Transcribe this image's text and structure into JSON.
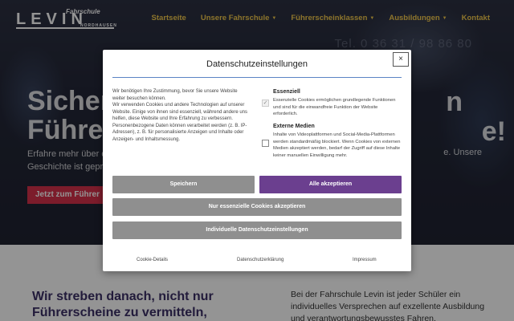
{
  "logo": {
    "top": "Fahrschule",
    "main": "LEVIN",
    "sub": "NORDHAUSEN"
  },
  "nav": [
    {
      "label": "Startseite",
      "dropdown": false
    },
    {
      "label": "Unsere Fahrschule",
      "dropdown": true
    },
    {
      "label": "Führerscheinklassen",
      "dropdown": true
    },
    {
      "label": "Ausbildungen",
      "dropdown": true
    },
    {
      "label": "Kontakt",
      "dropdown": false
    }
  ],
  "hero": {
    "phone": "Tel. 0 36 31 / 98 86 80",
    "title_line1": "Sicher",
    "title_line1_tail": "n",
    "title_line2": "Führer",
    "title_line2_tail": "e!",
    "text_line1": "Erfahre mehr über di",
    "text_line1_tail": "e. Unsere",
    "text_line2": "Geschichte ist geprä",
    "cta": "Jetzt zum Führer"
  },
  "lower": {
    "title": "Wir streben danach, nicht nur Führerscheine zu vermitteln,",
    "text": "Bei der Fahrschule Levin ist jeder Schüler ein individuelles Versprechen auf exzellente Ausbildung und verantwortungsbewusstes Fahren."
  },
  "modal": {
    "title": "Datenschutzeinstellungen",
    "close": "×",
    "intro": "Wir benötigen Ihre Zustimmung, bevor Sie unsere Website weiter besuchen können.\nWir verwenden Cookies und andere Technologien auf unserer Website. Einige von ihnen sind essenziell, während andere uns helfen, diese Website und Ihre Erfahrung zu verbessern. Personenbezogene Daten können verarbeitet werden (z. B. IP-Adressen), z. B. für personalisierte Anzeigen und Inhalte oder Anzeigen- und Inhaltsmessung.",
    "categories": [
      {
        "title": "Essenziell",
        "desc": "Essenzielle Cookies ermöglichen grundlegende Funktionen und sind für die einwandfreie Funktion der Website erforderlich.",
        "checked": true
      },
      {
        "title": "Externe Medien",
        "desc": "Inhalte von Videoplattformen und Social-Media-Plattformen werden standardmäßig blockiert. Wenn Cookies von externen Medien akzeptiert werden, bedarf der Zugriff auf diese Inhalte keiner manuellen Einwilligung mehr.",
        "checked": false
      }
    ],
    "buttons": {
      "save": "Speichern",
      "accept_all": "Alle akzeptieren",
      "essential_only": "Nur essenzielle Cookies akzeptieren",
      "individual": "Individuelle Datenschutzeinstellungen"
    },
    "footer_links": [
      "Cookie-Details",
      "Datenschutzerklärung",
      "Impressum"
    ]
  }
}
